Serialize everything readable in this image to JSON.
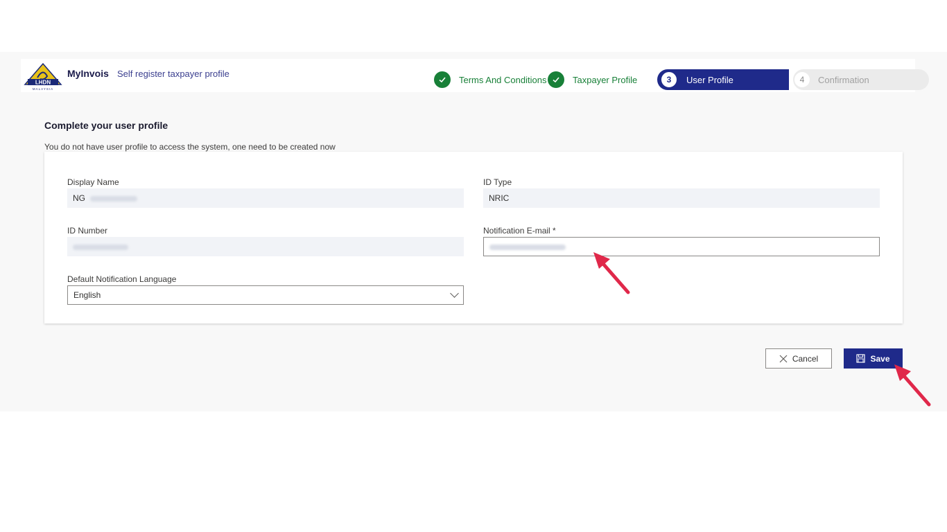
{
  "header": {
    "logo_text": "LHDN",
    "logo_sub": "MALAYSIA",
    "app_name": "MyInvois",
    "app_subtitle": "Self register taxpayer profile"
  },
  "steps": [
    {
      "label": "Terms And Conditions",
      "state": "done"
    },
    {
      "label": "Taxpayer Profile",
      "state": "done"
    },
    {
      "number": "3",
      "label": "User Profile",
      "state": "active"
    },
    {
      "number": "4",
      "label": "Confirmation",
      "state": "pending"
    }
  ],
  "section": {
    "title": "Complete your user profile",
    "description": "You do not have user profile to access the system, one need to be created now"
  },
  "form": {
    "display_name": {
      "label": "Display Name",
      "value_visible": "NG"
    },
    "id_type": {
      "label": "ID Type",
      "value": "NRIC"
    },
    "id_number": {
      "label": "ID Number"
    },
    "notification_email": {
      "label": "Notification E-mail *"
    },
    "language": {
      "label": "Default Notification Language",
      "value": "English"
    }
  },
  "actions": {
    "cancel_label": "Cancel",
    "save_label": "Save"
  },
  "colors": {
    "primary": "#1f2a8a",
    "success": "#188038",
    "annotation_arrow": "#e0284a"
  }
}
